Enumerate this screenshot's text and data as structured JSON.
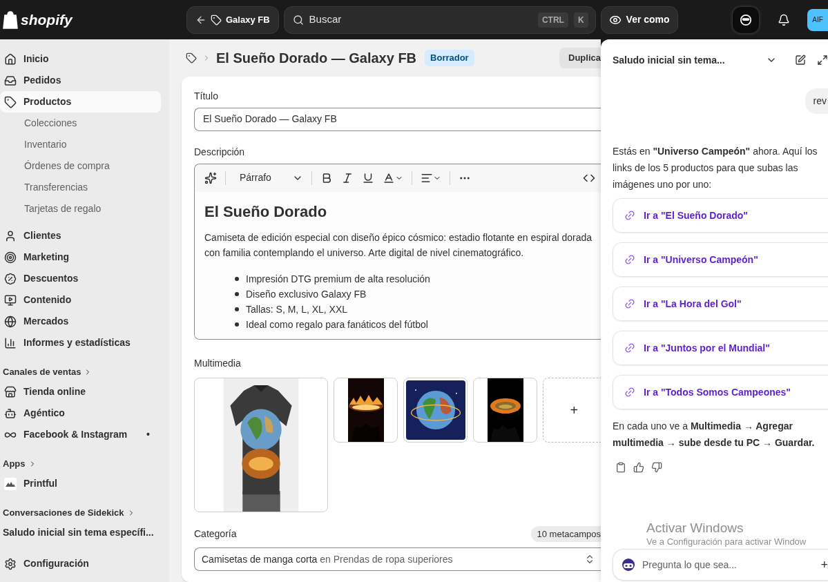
{
  "topbar": {
    "logo": "shopify",
    "back": {
      "label": "Galaxy FB"
    },
    "search": {
      "placeholder": "Buscar",
      "keys": [
        "CTRL",
        "K"
      ]
    },
    "view_as": "Ver como",
    "avatar": "AIF"
  },
  "sidebar": {
    "items": [
      {
        "label": "Inicio",
        "kind": "home",
        "selected": false
      },
      {
        "label": "Pedidos",
        "kind": "inbox",
        "selected": false
      },
      {
        "label": "Productos",
        "kind": "tag",
        "selected": true,
        "children": [
          {
            "label": "Colecciones"
          },
          {
            "label": "Inventario"
          },
          {
            "label": "Órdenes de compra"
          },
          {
            "label": "Transferencias"
          },
          {
            "label": "Tarjetas de regalo"
          }
        ]
      },
      {
        "label": "Clientes",
        "kind": "user",
        "selected": false
      },
      {
        "label": "Marketing",
        "kind": "target",
        "selected": false
      },
      {
        "label": "Descuentos",
        "kind": "percent",
        "selected": false
      },
      {
        "label": "Contenido",
        "selected": false
      },
      {
        "label": "Mercados",
        "kind": "globe",
        "selected": false
      },
      {
        "label": "Informes y estadísticas",
        "kind": "chart",
        "selected": false
      }
    ],
    "sections": [
      {
        "heading": "Canales de ventas",
        "items": [
          {
            "label": "Tienda online",
            "kind": "store"
          },
          {
            "label": "Agéntico",
            "kind": "bot"
          },
          {
            "label": "Facebook & Instagram",
            "kind": "meta",
            "dot": "•"
          }
        ]
      },
      {
        "heading": "Apps",
        "items": [
          {
            "label": "Printful",
            "kind": "printful"
          }
        ]
      },
      {
        "heading": "Conversaciones de Sidekick",
        "items": [
          {
            "label": "Saludo inicial sin tema específi...",
            "kind": "conversation"
          }
        ]
      }
    ],
    "settings": "Configuración"
  },
  "header": {
    "title": "El Sueño Dorado — Galaxy FB",
    "status": "Borrador",
    "action": "Duplica"
  },
  "form": {
    "title_label": "Título",
    "title_value": "El Sueño Dorado — Galaxy FB",
    "description_label": "Descripción",
    "format": "Párrafo",
    "description": {
      "heading": "El Sueño Dorado",
      "paragraph": "Camiseta de edición especial con diseño épico cósmico: estadio flotante en espiral dorada con familia contemplando el universo. Arte digital de nivel cinematográfico.",
      "bullets": [
        "Impresión DTG premium de alta resolución",
        "Diseño exclusivo Galaxy FB",
        "Tallas: S, M, L, XL, XXL",
        "Ideal como regalo para fanáticos del fútbol"
      ]
    },
    "media_label": "Multimedia",
    "media": [
      {
        "kind": "shirt"
      },
      {
        "kind": "fire"
      },
      {
        "kind": "globe"
      },
      {
        "kind": "stadium"
      }
    ],
    "add_media": "+",
    "category_label": "Categoría",
    "metafields": "10 metacampos",
    "category": {
      "name": "Camisetas de manga corta",
      "path": "en Prendas de ropa superiores"
    }
  },
  "sidekick": {
    "title": "Saludo inicial sin tema...",
    "user_message": "rev",
    "message": [
      "Estás en **\"Universo Campeón\"** ahora. Aquí los",
      "links de los 5 productos para que subas las",
      "imágenes uno por uno:"
    ],
    "links": [
      "Ir a \"El Sueño Dorado\"",
      "Ir a \"Universo Campeón\"",
      "Ir a \"La Hora del Gol\"",
      "Ir a \"Juntos por el Mundial\"",
      "Ir a \"Todos Somos Campeones\""
    ],
    "footer": [
      "En cada uno ve a **Multimedia → Agregar**",
      "**multimedia → sube desde tu PC → Guardar.**"
    ],
    "input_placeholder": "Pregunta lo que sea...",
    "add": "+"
  },
  "os_notice": {
    "title": "Activar Windows",
    "text": "Ve a Configuración para activar Window"
  }
}
